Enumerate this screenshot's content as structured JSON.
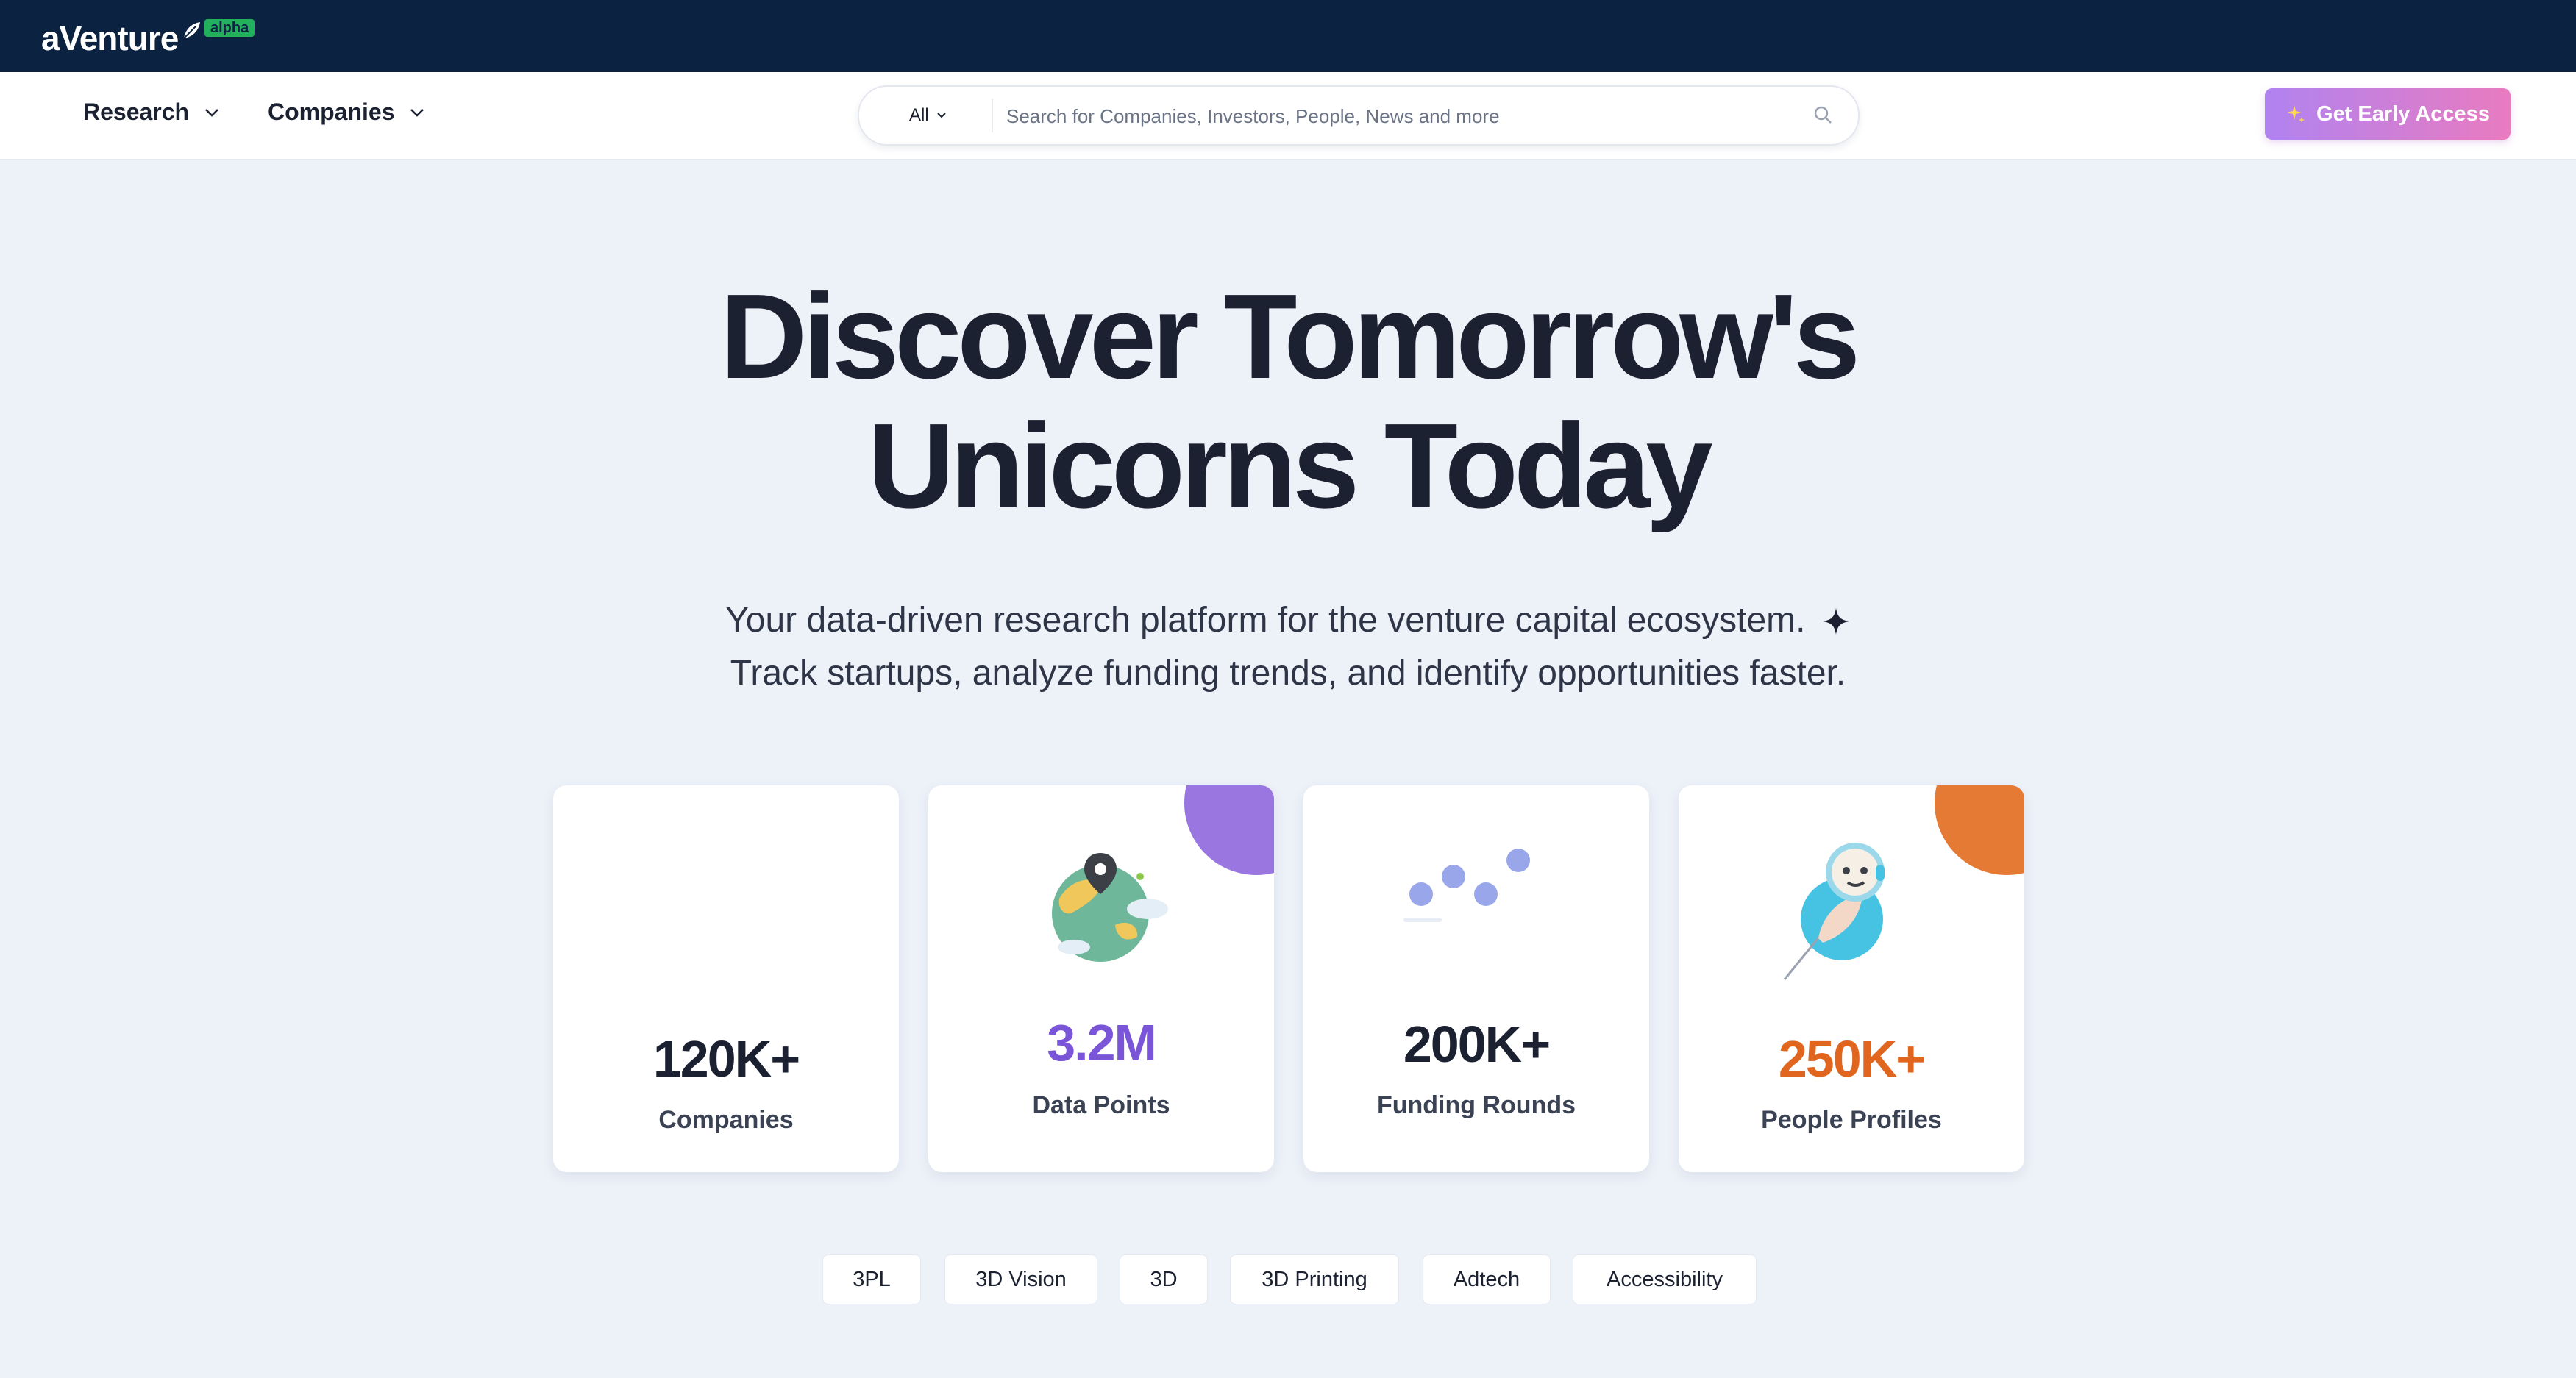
{
  "brand": {
    "logo_text": "aVenture",
    "badge": "alpha",
    "leaf_icon": "leaf-icon"
  },
  "nav": {
    "research_label": "Research",
    "companies_label": "Companies"
  },
  "search": {
    "scope": "All",
    "placeholder": "Search for Companies, Investors, People, News and more"
  },
  "cta": {
    "label": "Get Early Access",
    "icon": "sparkles-icon"
  },
  "hero": {
    "title_line1": "Discover Tomorrow's",
    "title_line2": "Unicorns Today",
    "subtitle_line1": "Your data-driven research platform for the venture capital ecosystem.",
    "subtitle_line2": "Track startups, analyze funding trends, and identify opportunities faster."
  },
  "stats": [
    {
      "value": "120K+",
      "label": "Companies",
      "color": "#1b2130"
    },
    {
      "value": "3.2M",
      "label": "Data Points",
      "color": "#7b55d8"
    },
    {
      "value": "200K+",
      "label": "Funding Rounds",
      "color": "#1b2130"
    },
    {
      "value": "250K+",
      "label": "People Profiles",
      "color": "#e0661f"
    }
  ],
  "tags": [
    "3PL",
    "3D Vision",
    "3D",
    "3D Printing",
    "Adtech",
    "Accessibility"
  ],
  "colors": {
    "topbar": "#0b2240",
    "background": "#edf1f8",
    "accent_purple": "#9a76e0",
    "accent_orange": "#e57a35",
    "alpha_green": "#22b05c"
  }
}
